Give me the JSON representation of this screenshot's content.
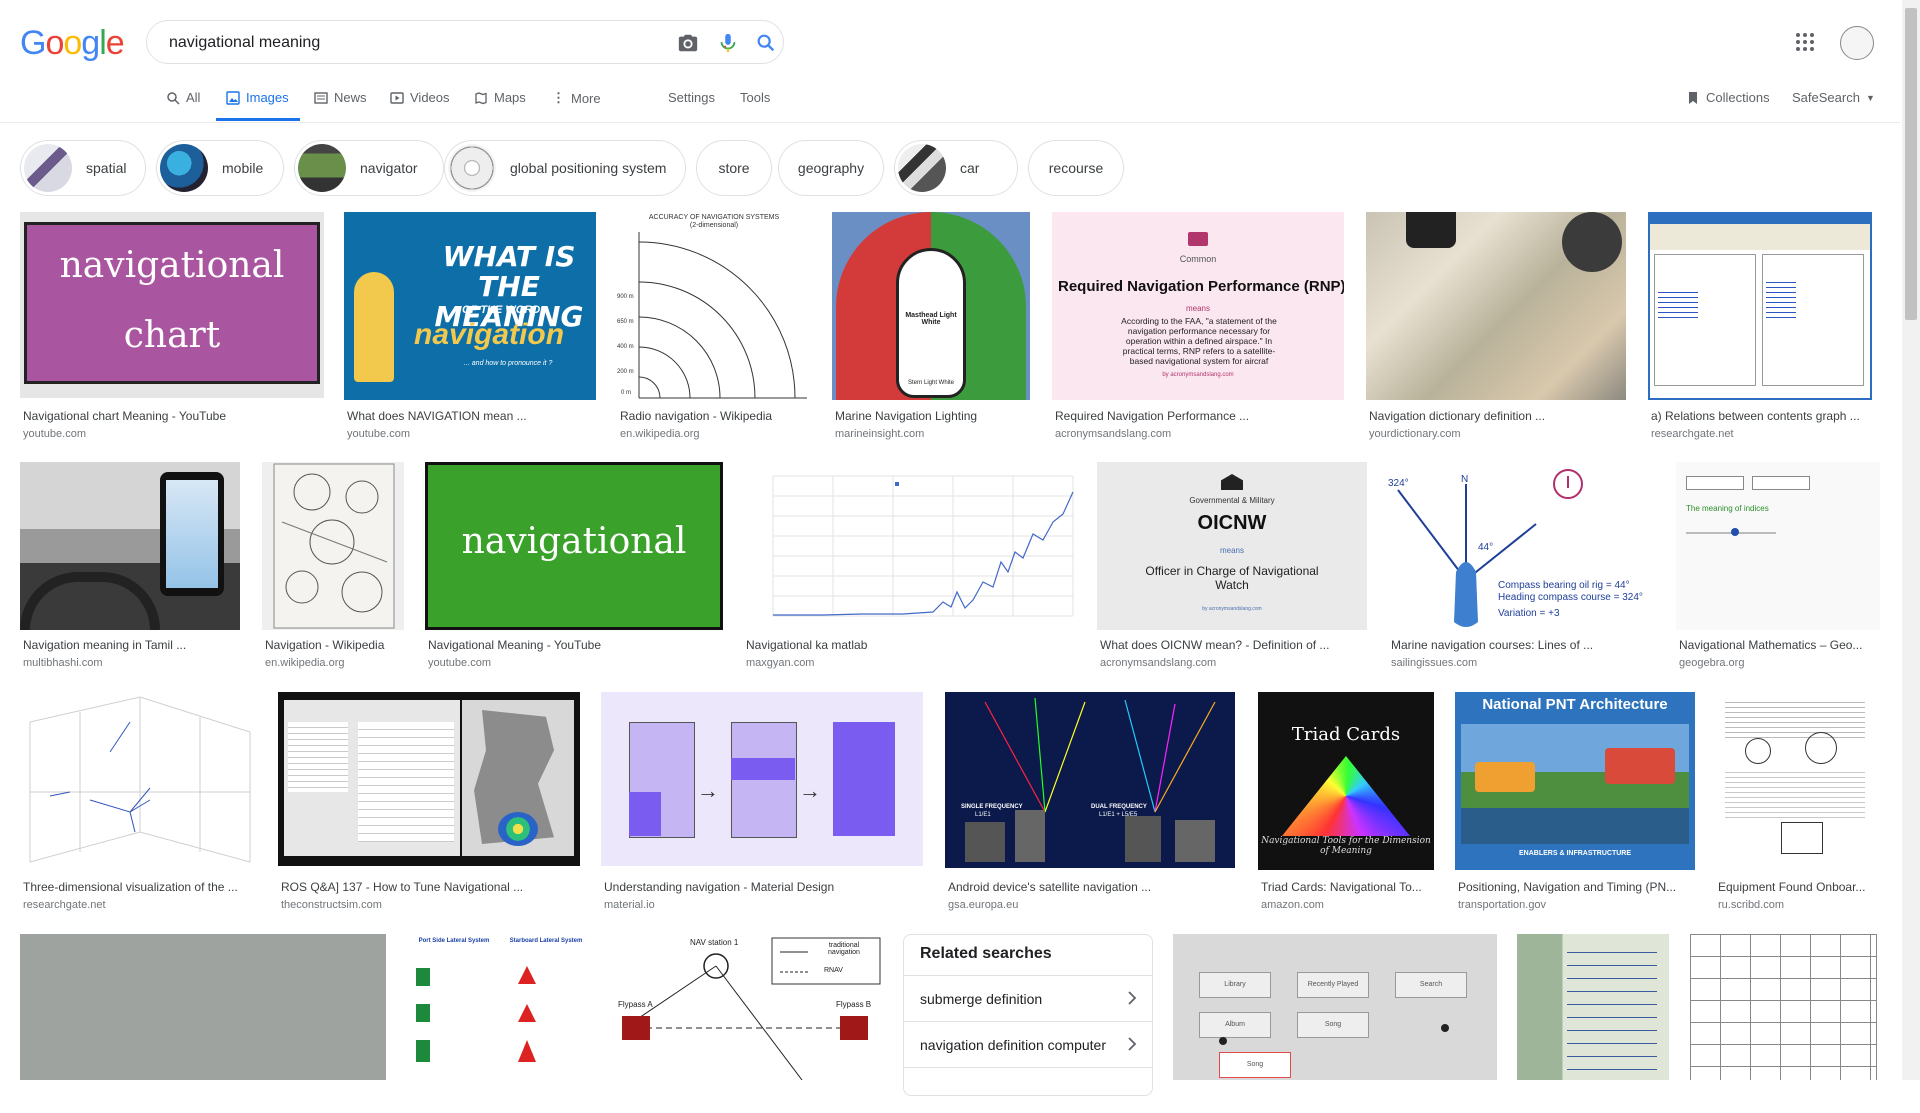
{
  "logo": {
    "text": "Google"
  },
  "search": {
    "query": "navigational meaning"
  },
  "tabs": [
    {
      "label": "All"
    },
    {
      "label": "Images"
    },
    {
      "label": "News"
    },
    {
      "label": "Videos"
    },
    {
      "label": "Maps"
    },
    {
      "label": "More"
    },
    {
      "label": "Settings"
    },
    {
      "label": "Tools"
    }
  ],
  "header_right": {
    "collections": "Collections",
    "safesearch": "SafeSearch"
  },
  "chips": [
    {
      "label": "spatial"
    },
    {
      "label": "mobile"
    },
    {
      "label": "navigator"
    },
    {
      "label": "global positioning system"
    },
    {
      "label": "store"
    },
    {
      "label": "geography"
    },
    {
      "label": "car"
    },
    {
      "label": "recourse"
    }
  ],
  "results": [
    {
      "title": "Navigational chart Meaning - YouTube",
      "source": "youtube.com",
      "img_text": [
        "navigational",
        "chart"
      ]
    },
    {
      "title": "What does NAVIGATION mean ...",
      "source": "youtube.com",
      "img_text": [
        "WHAT IS",
        "THE MEANING",
        "OF THE WORD",
        "navigation",
        "... and how to pronounce it ?"
      ]
    },
    {
      "title": "Radio navigation - Wikipedia",
      "source": "en.wikipedia.org",
      "img_text": [
        "ACCURACY OF NAVIGATION SYSTEMS",
        "(2-dimensional)",
        "900 m",
        "650 m",
        "400 m",
        "200 m",
        "0 m"
      ]
    },
    {
      "title": "Marine Navigation Lighting",
      "source": "marineinsight.com",
      "img_text": [
        "Masthead Light White",
        "Stern Light White"
      ]
    },
    {
      "title": "Required Navigation Performance ...",
      "source": "acronymsandslang.com",
      "img_text": [
        "Common",
        "Required Navigation Performance (RNP)",
        "means",
        "According to the FAA, \"a statement of the navigation performance necessary for operation within a defined airspace.\" In practical terms, RNP refers to a satellite-based navigational system for aircraf",
        "by acronymsandslang.com"
      ]
    },
    {
      "title": "Navigation dictionary definition ...",
      "source": "yourdictionary.com"
    },
    {
      "title": "a) Relations between contents graph ...",
      "source": "researchgate.net"
    },
    {
      "title": "Navigation meaning in Tamil ...",
      "source": "multibhashi.com"
    },
    {
      "title": "Navigation - Wikipedia",
      "source": "en.wikipedia.org"
    },
    {
      "title": "Navigational Meaning - YouTube",
      "source": "youtube.com",
      "img_text": [
        "navigational"
      ]
    },
    {
      "title": "Navigational ka matlab",
      "source": "maxgyan.com"
    },
    {
      "title": "What does OICNW mean? - Definition of ...",
      "source": "acronymsandslang.com",
      "img_text": [
        "Governmental & Military",
        "OICNW",
        "means",
        "Officer in Charge of Navigational Watch",
        "by acronymsandslang.com"
      ]
    },
    {
      "title": "Marine navigation courses: Lines of ...",
      "source": "sailingissues.com",
      "img_text": [
        "324°",
        "N",
        "44°",
        "Compass bearing oil rig = 44°",
        "Heading compass course = 324°",
        "Variation = +3"
      ]
    },
    {
      "title": "Navigational Mathematics – Geo...",
      "source": "geogebra.org",
      "img_text": [
        "The meaning of indices"
      ]
    },
    {
      "title": "Three-dimensional visualization of the ...",
      "source": "researchgate.net"
    },
    {
      "title": "ROS Q&A] 137 - How to Tune Navigational ...",
      "source": "theconstructsim.com"
    },
    {
      "title": "Understanding navigation - Material Design",
      "source": "material.io"
    },
    {
      "title": "Android device's satellite navigation ...",
      "source": "gsa.europa.eu",
      "img_text": [
        "SINGLE FREQUENCY",
        "L1/E1",
        "DUAL FREQUENCY",
        "L1/E1 + L5/E5"
      ]
    },
    {
      "title": "Triad Cards: Navigational To...",
      "source": "amazon.com",
      "img_text": [
        "Triad Cards",
        "Navigational Tools for the Dimension of Meaning"
      ]
    },
    {
      "title": "Positioning, Navigation and Timing (PN...",
      "source": "transportation.gov",
      "img_text": [
        "National PNT Architecture",
        "ENABLERS & INFRASTRUCTURE"
      ]
    },
    {
      "title": "Equipment Found Onboar...",
      "source": "ru.scribd.com"
    }
  ],
  "bottom_row": {
    "lateral": [
      "Port Side Lateral System",
      "Starboard Lateral System"
    ],
    "rnav": [
      "NAV station 1",
      "traditional navigation",
      "RNAV",
      "Flypass A",
      "Flypass B"
    ],
    "wire": [
      "Library",
      "Recently Played",
      "Search",
      "Album",
      "Song",
      "Song"
    ]
  },
  "related": {
    "heading": "Related searches",
    "items": [
      "submerge definition",
      "navigation definition computer"
    ]
  }
}
